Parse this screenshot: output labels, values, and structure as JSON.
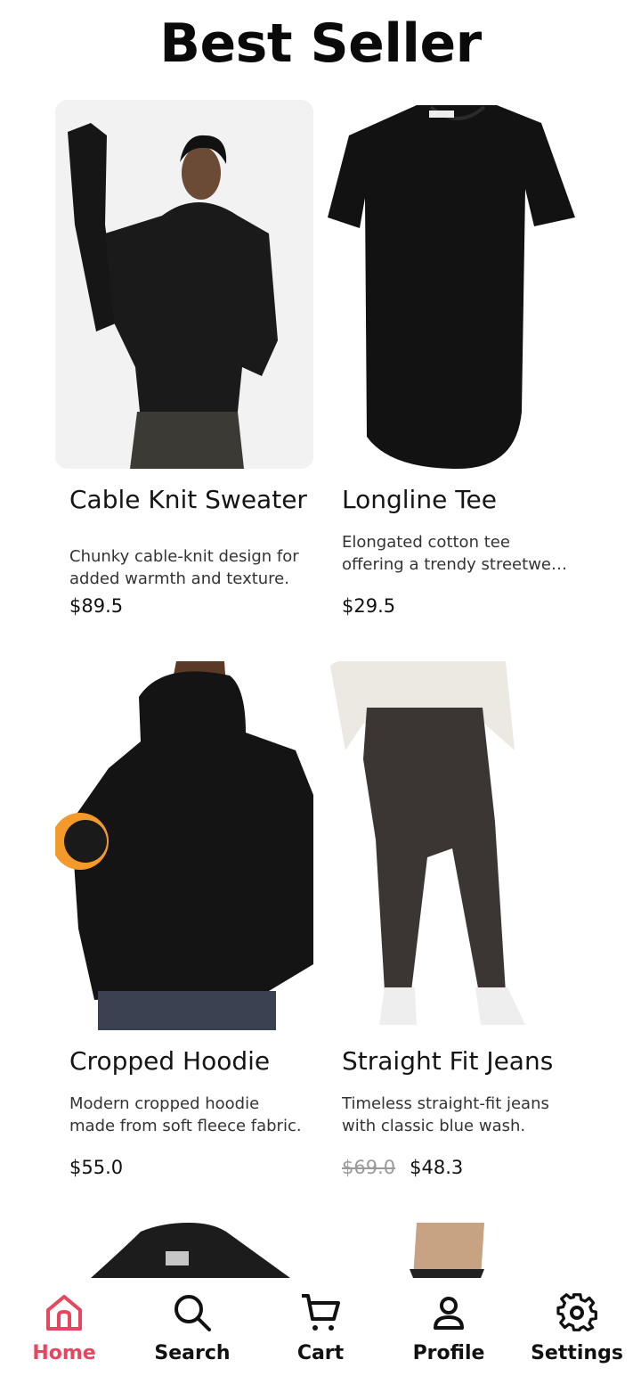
{
  "header": {
    "title": "Best Seller"
  },
  "products": [
    {
      "name": "Cable Knit Sweater",
      "description": "Chunky cable-knit design for added warmth and texture.",
      "price": "$89.5",
      "image": "black-cable-knit-sweater-photo"
    },
    {
      "name": "Longline Tee",
      "description": "Elongated cotton tee offering a trendy streetwear look.",
      "price": "$29.5",
      "image": "black-longline-tee-photo"
    },
    {
      "name": "Cropped Hoodie",
      "description": "Modern cropped hoodie made from soft fleece fabric.",
      "price": "$55.0",
      "image": "black-cropped-hoodie-photo"
    },
    {
      "name": "Straight Fit Jeans",
      "description": "Timeless straight-fit jeans with classic blue wash.",
      "old_price": "$69.0",
      "price": "$48.3",
      "image": "straight-fit-jeans-photo"
    }
  ],
  "bottom_nav": {
    "active": "Home",
    "accent_color": "#e8465f",
    "items": [
      {
        "label": "Home",
        "icon": "home-icon"
      },
      {
        "label": "Search",
        "icon": "search-icon"
      },
      {
        "label": "Cart",
        "icon": "cart-icon"
      },
      {
        "label": "Profile",
        "icon": "profile-icon"
      },
      {
        "label": "Settings",
        "icon": "gear-icon"
      }
    ]
  }
}
